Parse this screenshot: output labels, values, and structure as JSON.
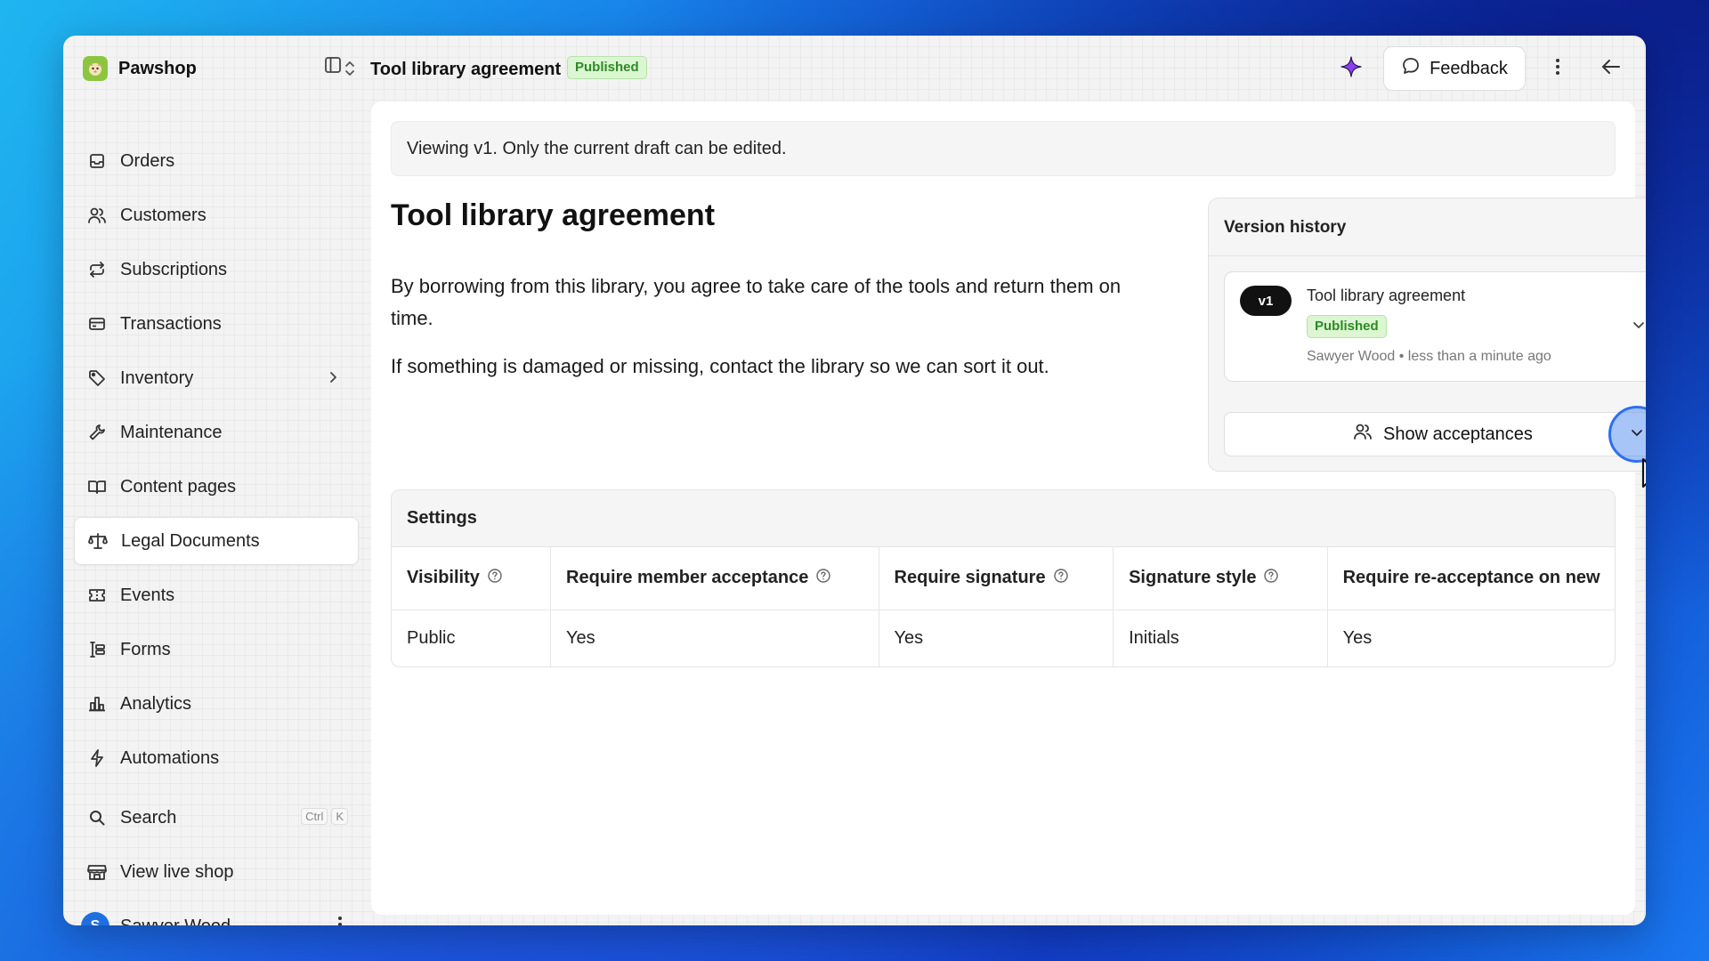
{
  "shop": {
    "name": "Pawshop"
  },
  "header": {
    "title": "Tool library agreement",
    "status_badge": "Published",
    "feedback_label": "Feedback"
  },
  "sidebar": {
    "items": [
      {
        "label": "Orders",
        "icon": "inbox-icon"
      },
      {
        "label": "Customers",
        "icon": "users-icon"
      },
      {
        "label": "Subscriptions",
        "icon": "repeat-icon"
      },
      {
        "label": "Transactions",
        "icon": "credit-card-icon"
      },
      {
        "label": "Inventory",
        "icon": "tag-icon"
      },
      {
        "label": "Maintenance",
        "icon": "wrench-icon"
      },
      {
        "label": "Content pages",
        "icon": "book-icon"
      },
      {
        "label": "Legal Documents",
        "icon": "scale-icon"
      },
      {
        "label": "Events",
        "icon": "ticket-icon"
      },
      {
        "label": "Forms",
        "icon": "form-icon"
      },
      {
        "label": "Analytics",
        "icon": "bar-chart-icon"
      },
      {
        "label": "Automations",
        "icon": "bolt-icon"
      }
    ],
    "search": {
      "label": "Search",
      "shortcut_ctrl": "Ctrl",
      "shortcut_key": "K"
    },
    "view_shop": "View live shop",
    "user": {
      "name": "Sawyer Wood",
      "initial": "S"
    }
  },
  "main": {
    "notice": "Viewing v1. Only the current draft can be edited.",
    "title": "Tool library agreement",
    "paragraphs": [
      "By borrowing from this library, you agree to take care of the tools and return them on time.",
      "If something is damaged or missing, contact the library so we can sort it out."
    ]
  },
  "version_history": {
    "title": "Version history",
    "version": {
      "tag": "v1",
      "name": "Tool library agreement",
      "status": "Published",
      "meta": "Sawyer Wood • less than a minute ago"
    },
    "show_acceptances": "Show acceptances"
  },
  "settings": {
    "title": "Settings",
    "columns": [
      "Visibility",
      "Require member acceptance",
      "Require signature",
      "Signature style",
      "Require re-acceptance on new"
    ],
    "row": [
      "Public",
      "Yes",
      "Yes",
      "Initials",
      "Yes"
    ]
  },
  "colors": {
    "accent_badge_bg": "#dcf5d3",
    "accent_badge_text": "#2e8a23",
    "avatar": "#1f6fe0",
    "ai_icon": "#8b3ff0"
  }
}
